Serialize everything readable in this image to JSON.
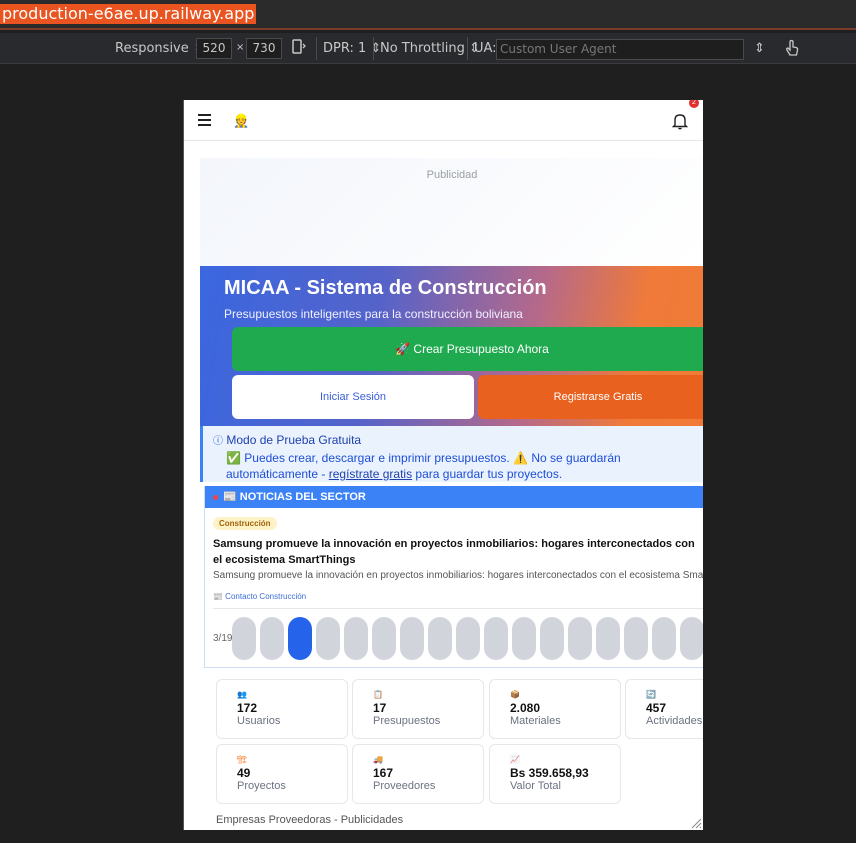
{
  "browser": {
    "url": "production-e6ae.up.railway.app"
  },
  "devtools": {
    "device": "Responsive",
    "width": "520",
    "height": "730",
    "dpr": "DPR: 1",
    "throttling": "No Throttling",
    "ua_label": "UA:",
    "ua_placeholder": "Custom User Agent"
  },
  "app": {
    "ad_label": "Publicidad",
    "hero": {
      "title": "MICAA - Sistema de Construcción",
      "subtitle": "Presupuestos inteligentes para la construcción boliviana",
      "create_button": "🚀 Crear Presupuesto Ahora",
      "login_button": "Iniciar Sesión",
      "register_button": "Registrarse Gratis"
    },
    "trial": {
      "title": "Modo de Prueba Gratuita",
      "line1": "✅ Puedes crear, descargar e imprimir presupuestos. ⚠️ No se guardarán",
      "line2_pre": "automáticamente - ",
      "line2_link": "regístrate gratis",
      "line2_post": " para guardar tus proyectos."
    },
    "news": {
      "header": "📰 NOTICIAS DEL SECTOR",
      "tag": "Construcción",
      "title": "Samsung promueve la innovación en proyectos inmobiliarios: hogares interconectados con el ecosistema SmartThings",
      "summary": "Samsung promueve la innovación en proyectos inmobiliarios: hogares interconectados con el ecosistema SmartThings",
      "source": "📰 Contacto Construcción",
      "page": "3/19",
      "total": 17,
      "active_index": 2
    },
    "stats": [
      {
        "icon": "👥",
        "value": "172",
        "label": "Usuarios",
        "color": "#3b82f6"
      },
      {
        "icon": "📋",
        "value": "17",
        "label": "Presupuestos",
        "color": "#22c55e"
      },
      {
        "icon": "📦",
        "value": "2.080",
        "label": "Materiales",
        "color": "#6366f1"
      },
      {
        "icon": "🔄",
        "value": "457",
        "label": "Actividades",
        "color": "#a855f7"
      },
      {
        "icon": "🏗",
        "value": "49",
        "label": "Proyectos",
        "color": "#f97316"
      },
      {
        "icon": "🚚",
        "value": "167",
        "label": "Proveedores",
        "color": "#ef4444"
      },
      {
        "icon": "📈",
        "value": "Bs 359.658,93",
        "label": "Valor Total",
        "color": "#10b981"
      }
    ],
    "footer_label": "Empresas Proveedoras - Publicidades",
    "notifications_count": "2"
  }
}
